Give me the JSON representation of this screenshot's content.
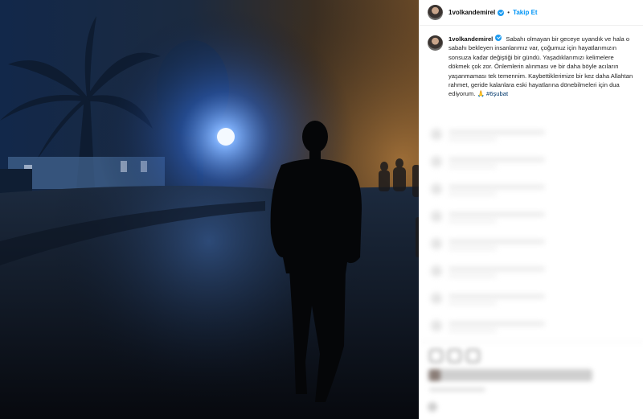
{
  "post": {
    "username": "1volkandemirel",
    "follow_label": "Takip Et",
    "separator": "•",
    "caption_text": "Sabahı olmayan bir geceye uyandık ve hala o sabahı bekleyen insanlarımız var, çoğumuz için hayatlarımızın sonsuza kadar değiştiği bir gündü. Yaşadıklarımızı kelimelere dökmek çok zor. Önlemlerin alınması ve bir daha böyle acıların yaşanmaması tek temennim. Kaybettiklerimize bir kez daha Allahtan rahmet, geride kalanlara eski hayatlarına dönebilmeleri için dua ediyorum. 🙏",
    "hashtag": "#6şubat"
  },
  "icons": {
    "verified": "verified-badge-icon",
    "like": "heart-icon",
    "comment": "comment-icon",
    "share": "share-icon"
  },
  "colors": {
    "accent": "#0095f6",
    "verified": "#1d9bf0",
    "hashtag": "#00376b",
    "streetlight": "#4a8bff"
  }
}
